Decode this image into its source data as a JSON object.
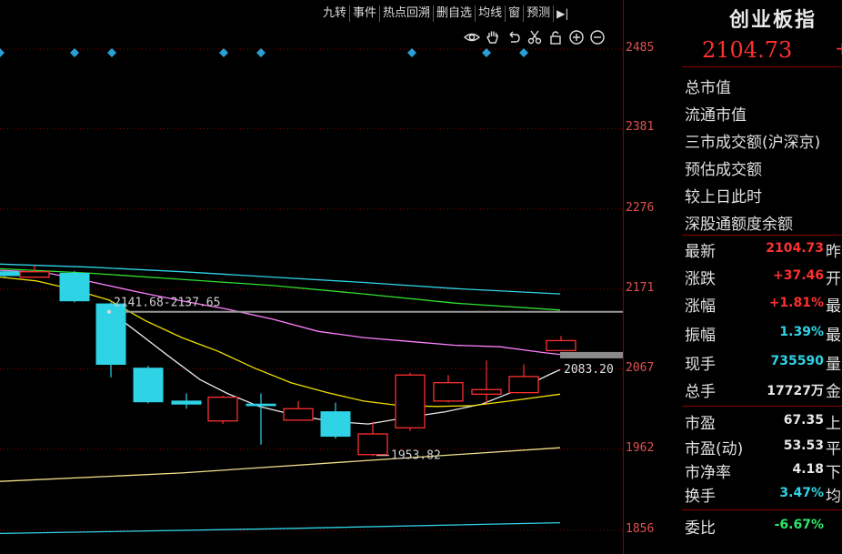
{
  "toolbar": {
    "items": [
      "九转",
      "事件",
      "热点回溯",
      "删自选",
      "均线",
      "窗",
      "预测"
    ],
    "arrow_icon": "collapse-right-icon"
  },
  "chart_icons": [
    "eye-icon",
    "hand-icon",
    "undo-icon",
    "scissors-icon",
    "lock-icon",
    "zoom-in-icon",
    "zoom-out-icon"
  ],
  "chart_data": {
    "type": "candlestick",
    "title": "",
    "y_ticks": [
      2485,
      2381,
      2276,
      2171,
      2067,
      1962,
      1856
    ],
    "ylim": [
      1840,
      2520
    ],
    "up_color": "#ff3030",
    "down_color": "#2fd3e6",
    "candles": [
      {
        "o": 2194,
        "h": 2196,
        "c": 2189,
        "l": 2187
      },
      {
        "o": 2187,
        "h": 2202,
        "c": 2194,
        "l": 2186
      },
      {
        "o": 2192,
        "h": 2195,
        "c": 2156,
        "l": 2154
      },
      {
        "o": 2152,
        "h": 2154,
        "c": 2073,
        "l": 2056
      },
      {
        "o": 2068,
        "h": 2071,
        "c": 2024,
        "l": 2022
      },
      {
        "o": 2025,
        "h": 2035,
        "c": 2021,
        "l": 2015
      },
      {
        "o": 1999,
        "h": 2032,
        "c": 2030,
        "l": 1995
      },
      {
        "o": 2021,
        "h": 2035,
        "c": 2019,
        "l": 1968
      },
      {
        "o": 2000,
        "h": 2025,
        "c": 2015,
        "l": 2000
      },
      {
        "o": 2011,
        "h": 2023,
        "c": 1979,
        "l": 1976
      },
      {
        "o": 1955,
        "h": 1998,
        "c": 1982,
        "l": 1953
      },
      {
        "o": 1990,
        "h": 2062,
        "c": 2059,
        "l": 1986
      },
      {
        "o": 2025,
        "h": 2059,
        "c": 2049,
        "l": 2023
      },
      {
        "o": 2034,
        "h": 2078,
        "c": 2040,
        "l": 2022
      },
      {
        "o": 2036,
        "h": 2073,
        "c": 2057,
        "l": 2035
      },
      {
        "o": 2091,
        "h": 2110,
        "c": 2104,
        "l": 2090
      }
    ],
    "series": [
      {
        "color": "#e8e8e8",
        "values": [
          [
            120,
            2143
          ],
          [
            150,
            2116
          ],
          [
            185,
            2084
          ],
          [
            220,
            2053
          ],
          [
            250,
            2035
          ],
          [
            285,
            2018
          ],
          [
            330,
            2005
          ],
          [
            370,
            1998
          ],
          [
            405,
            1995
          ],
          [
            450,
            2004
          ],
          [
            490,
            2011
          ],
          [
            530,
            2021
          ],
          [
            570,
            2040
          ],
          [
            605,
            2060
          ],
          [
            616,
            2066
          ]
        ]
      },
      {
        "color": "#f0e000",
        "values": [
          [
            0,
            2187
          ],
          [
            40,
            2182
          ],
          [
            80,
            2171
          ],
          [
            120,
            2157
          ],
          [
            160,
            2130
          ],
          [
            200,
            2108
          ],
          [
            240,
            2090
          ],
          [
            280,
            2068
          ],
          [
            320,
            2049
          ],
          [
            360,
            2036
          ],
          [
            400,
            2025
          ],
          [
            440,
            2019
          ],
          [
            480,
            2018
          ],
          [
            520,
            2019
          ],
          [
            560,
            2025
          ],
          [
            616,
            2034
          ]
        ]
      },
      {
        "color": "#ff80ff",
        "values": [
          [
            0,
            2196
          ],
          [
            50,
            2193
          ],
          [
            100,
            2181
          ],
          [
            150,
            2168
          ],
          [
            200,
            2156
          ],
          [
            250,
            2145
          ],
          [
            300,
            2132
          ],
          [
            350,
            2116
          ],
          [
            400,
            2108
          ],
          [
            450,
            2103
          ],
          [
            500,
            2098
          ],
          [
            550,
            2096
          ],
          [
            600,
            2088
          ],
          [
            616,
            2086
          ]
        ]
      },
      {
        "color": "#30e030",
        "values": [
          [
            0,
            2198
          ],
          [
            100,
            2192
          ],
          [
            200,
            2184
          ],
          [
            300,
            2176
          ],
          [
            400,
            2165
          ],
          [
            500,
            2153
          ],
          [
            616,
            2144
          ]
        ]
      },
      {
        "color": "#2fd3e6",
        "values": [
          [
            0,
            2204
          ],
          [
            100,
            2200
          ],
          [
            200,
            2194
          ],
          [
            300,
            2187
          ],
          [
            400,
            2180
          ],
          [
            500,
            2172
          ],
          [
            616,
            2165
          ]
        ]
      },
      {
        "color": "#f2e08a",
        "values": [
          [
            0,
            1920
          ],
          [
            200,
            1931
          ],
          [
            400,
            1947
          ],
          [
            616,
            1964
          ]
        ]
      },
      {
        "color": "#2fd3e6",
        "values": [
          [
            0,
            1852
          ],
          [
            300,
            1858
          ],
          [
            616,
            1866
          ]
        ]
      }
    ],
    "annotations": [
      {
        "text": "2141.68-2137.65",
        "y": 2141.68
      },
      {
        "text": "1953.82",
        "y": 1953.82
      },
      {
        "text": "2083.20",
        "y": 2083.2
      }
    ],
    "event_markers": [
      0,
      82,
      123,
      246,
      287,
      453,
      535,
      576
    ]
  },
  "panel": {
    "title": "创业板指",
    "price": "2104.73",
    "price_suffix": "+",
    "metrics": [
      "总市值",
      "流通市值",
      "三市成交额(沪深京)",
      "预估成交额",
      "较上日此时",
      "深股通额度余额"
    ],
    "quotes": [
      {
        "label": "最新",
        "value": "2104.73",
        "color": "red",
        "cut": "昨"
      },
      {
        "label": "涨跌",
        "value": "+37.46",
        "color": "red",
        "cut": "开"
      },
      {
        "label": "涨幅",
        "value": "+1.81%",
        "color": "red",
        "cut": "最"
      },
      {
        "label": "振幅",
        "value": "1.39%",
        "color": "cyan",
        "cut": "最"
      },
      {
        "label": "现手",
        "value": "735590",
        "color": "cyan",
        "cut": "量"
      },
      {
        "label": "总手",
        "value": "17727万",
        "color": "white",
        "cut": "金"
      },
      {
        "label": "市盈",
        "value": "67.35",
        "color": "white",
        "cut": "上"
      },
      {
        "label": "市盈(动)",
        "value": "53.53",
        "color": "white",
        "cut": "平"
      },
      {
        "label": "市净率",
        "value": "4.18",
        "color": "white",
        "cut": "下"
      },
      {
        "label": "换手",
        "value": "3.47%",
        "color": "cyan",
        "cut": "均"
      },
      {
        "label": "委比",
        "value": "-6.67%",
        "color": "green",
        "cut": ""
      }
    ]
  }
}
